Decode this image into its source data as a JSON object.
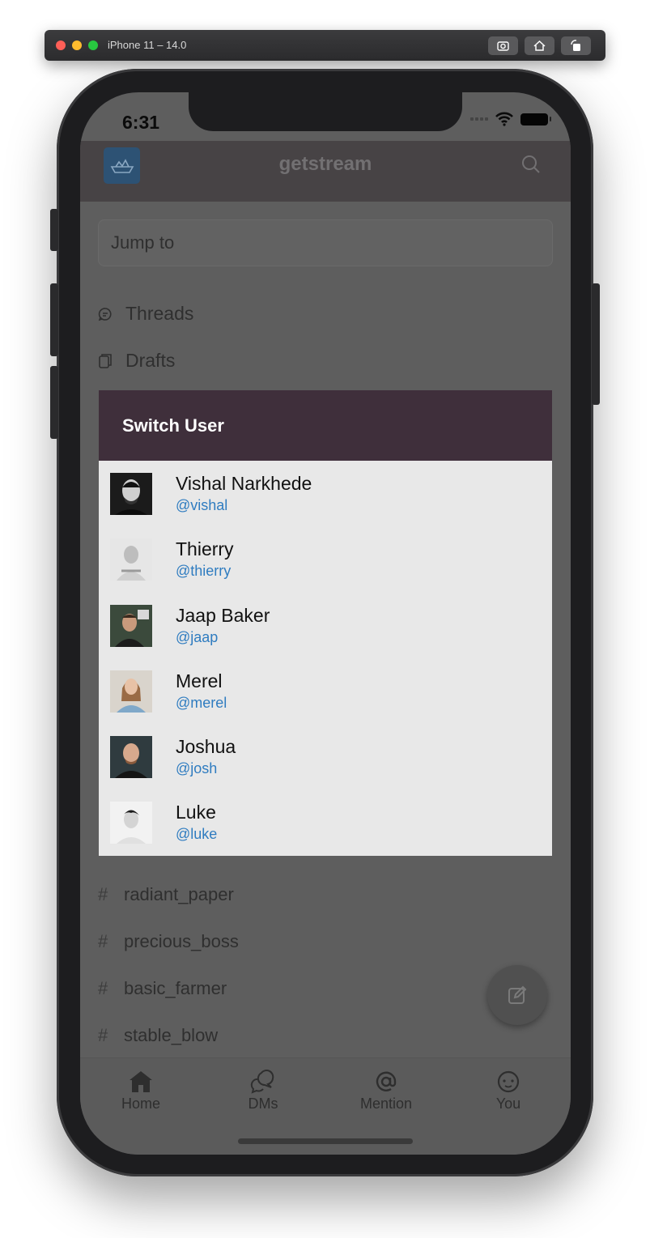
{
  "simulator": {
    "title": "iPhone 11 – 14.0"
  },
  "status": {
    "time": "6:31"
  },
  "header": {
    "title": "getstream"
  },
  "search": {
    "placeholder": "Jump to"
  },
  "nav": [
    {
      "label": "Threads",
      "icon": "threads-icon"
    },
    {
      "label": "Drafts",
      "icon": "drafts-icon"
    }
  ],
  "channels": [
    "radiant_paper",
    "precious_boss",
    "basic_farmer",
    "stable_blow"
  ],
  "channel_symbol": "#",
  "modal": {
    "title": "Switch User",
    "users": [
      {
        "name": "Vishal Narkhede",
        "handle": "@vishal"
      },
      {
        "name": "Thierry",
        "handle": "@thierry"
      },
      {
        "name": "Jaap Baker",
        "handle": "@jaap"
      },
      {
        "name": "Merel",
        "handle": "@merel"
      },
      {
        "name": "Joshua",
        "handle": "@josh"
      },
      {
        "name": "Luke",
        "handle": "@luke"
      }
    ]
  },
  "tabs": [
    {
      "label": "Home",
      "icon": "home-icon"
    },
    {
      "label": "DMs",
      "icon": "dms-icon"
    },
    {
      "label": "Mention",
      "icon": "mention-icon"
    },
    {
      "label": "You",
      "icon": "you-icon"
    }
  ],
  "colors": {
    "modal_header": "#3f2f3b",
    "handle": "#2f7cc0",
    "overlay": "#5e5e5e"
  }
}
